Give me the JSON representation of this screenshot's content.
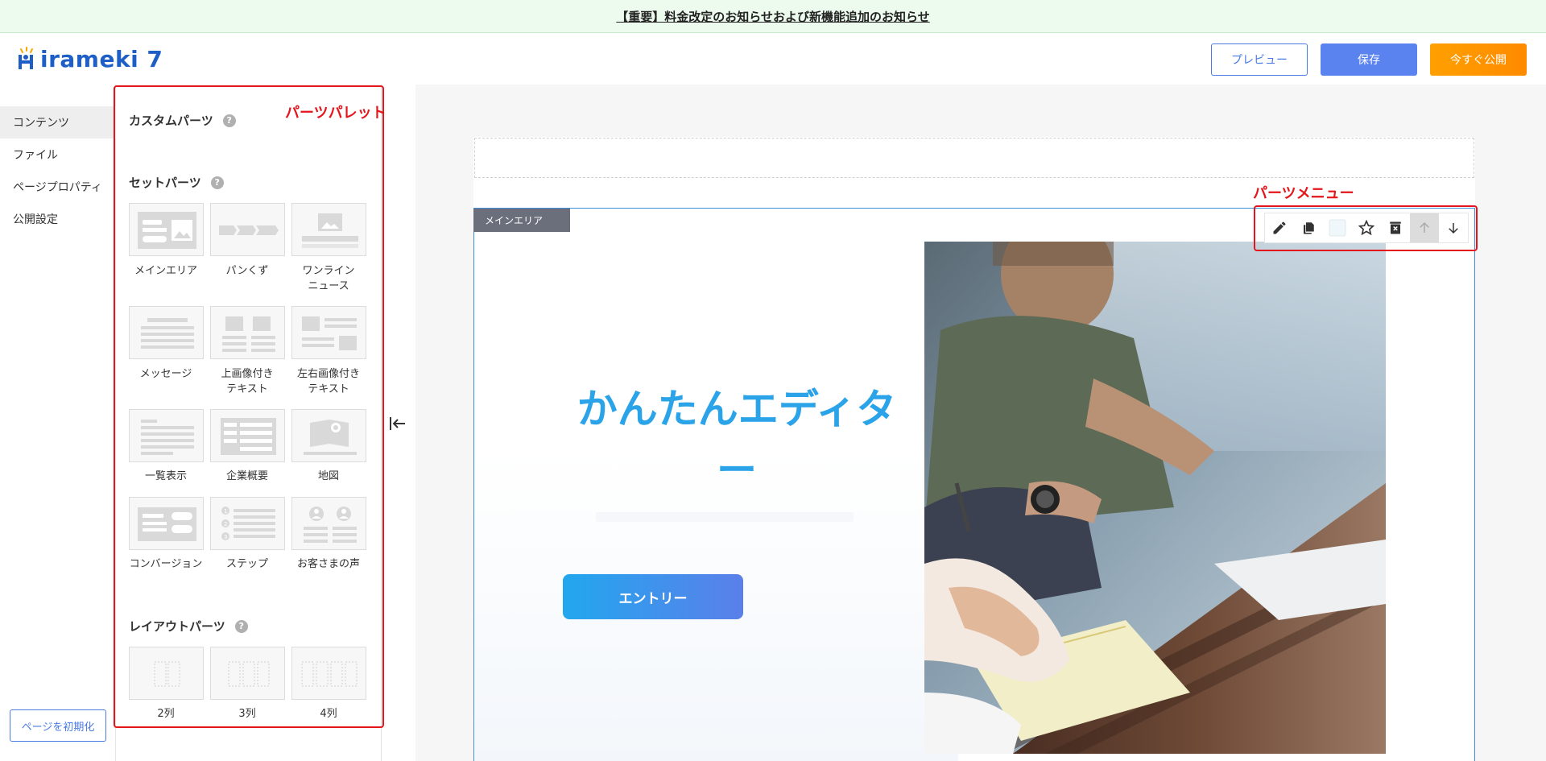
{
  "notice": {
    "text": "【重要】料金改定のお知らせおよび新機能追加のお知らせ"
  },
  "header": {
    "logo_text": "irameki 7",
    "preview_label": "プレビュー",
    "save_label": "保存",
    "publish_label": "今すぐ公開"
  },
  "nav": {
    "items": [
      {
        "label": "コンテンツ"
      },
      {
        "label": "ファイル"
      },
      {
        "label": "ページプロパティ"
      },
      {
        "label": "公開設定"
      }
    ],
    "reset_label": "ページを初期化"
  },
  "palette": {
    "annotation": "パーツパレット",
    "custom_title": "カスタムパーツ",
    "set_title": "セットパーツ",
    "layout_title": "レイアウトパーツ",
    "help": "?",
    "set_parts": [
      {
        "label": "メインエリア"
      },
      {
        "label": "パンくず"
      },
      {
        "label": "ワンライン\nニュース"
      },
      {
        "label": "メッセージ"
      },
      {
        "label": "上画像付き\nテキスト"
      },
      {
        "label": "左右画像付き\nテキスト"
      },
      {
        "label": "一覧表示"
      },
      {
        "label": "企業概要"
      },
      {
        "label": "地図"
      },
      {
        "label": "コンバージョン"
      },
      {
        "label": "ステップ"
      },
      {
        "label": "お客さまの声"
      }
    ],
    "layout_parts": [
      {
        "label": "2列"
      },
      {
        "label": "3列"
      },
      {
        "label": "4列"
      }
    ]
  },
  "canvas": {
    "area_tag": "メインエリア",
    "hero_title_1": "かんたんエディタ",
    "hero_title_2": "ー",
    "entry_label": "エントリー"
  },
  "parts_menu": {
    "annotation": "パーツメニュー"
  },
  "colors": {
    "accent": "#2aa3e8",
    "save": "#5b83f0",
    "publish": "#ff9800",
    "annotation": "#e4161b"
  }
}
